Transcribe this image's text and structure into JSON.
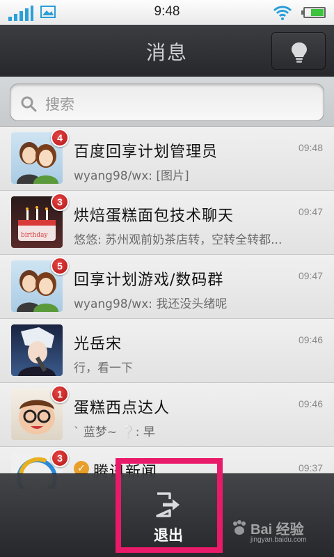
{
  "status_bar": {
    "time": "9:48"
  },
  "header": {
    "title": "消息"
  },
  "search": {
    "placeholder": "搜索"
  },
  "chats": [
    {
      "name": "百度回享计划管理员",
      "preview": "wyang98/wx: [图片]",
      "time": "09:48",
      "badge": "4"
    },
    {
      "name": "烘焙蛋糕面包技术聊天",
      "preview": "悠悠: 苏州观前奶茶店转，空转全转都...",
      "time": "09:47",
      "badge": "3"
    },
    {
      "name": "回享计划游戏/数码群",
      "preview": "wyang98/wx: 我还没头绪呢",
      "time": "09:47",
      "badge": "5"
    },
    {
      "name": "光岳宋",
      "preview": "行，看一下",
      "time": "09:46",
      "badge": ""
    },
    {
      "name": "蛋糕西点达人",
      "preview": "` 蓝梦~ ❔: 早",
      "time": "09:46",
      "badge": "1"
    },
    {
      "name": "腾讯新闻",
      "preview": "",
      "time": "09:37",
      "badge": "3"
    }
  ],
  "menu": {
    "exit_label": "退出"
  },
  "watermark": {
    "main": "Bai 经验",
    "sub": "jingyan.baidu.com"
  },
  "colors": {
    "accent_highlight": "#ea1a6a",
    "badge_red": "#c8202a",
    "signal_blue": "#2a9fd8"
  }
}
